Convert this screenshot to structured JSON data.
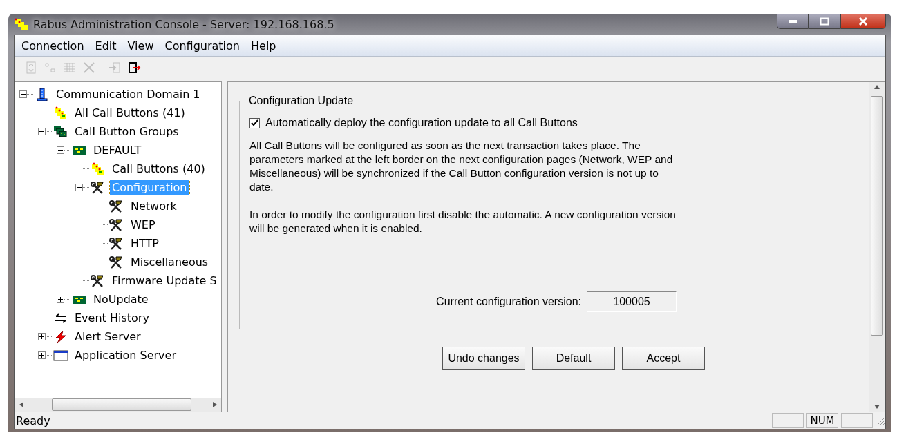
{
  "window": {
    "title": "Rabus Administration Console - Server: 192.168.168.5"
  },
  "menu": [
    "Connection",
    "Edit",
    "View",
    "Configuration",
    "Help"
  ],
  "toolbar": [
    {
      "kind": "refresh",
      "disabled": true
    },
    {
      "kind": "rename",
      "disabled": true
    },
    {
      "kind": "list",
      "disabled": true
    },
    {
      "kind": "delete",
      "disabled": true
    },
    {
      "kind": "sep"
    },
    {
      "kind": "login",
      "disabled": true
    },
    {
      "kind": "logout",
      "disabled": false
    }
  ],
  "tree": [
    {
      "label": "Communication Domain 1",
      "kind": "domain",
      "expanded": true,
      "selected": false,
      "children": [
        {
          "label": "All Call Buttons (41)",
          "kind": "buttons",
          "selected": false
        },
        {
          "label": "Call Button Groups",
          "kind": "groups",
          "expanded": true,
          "selected": false,
          "children": [
            {
              "label": "DEFAULT",
              "kind": "board",
              "expanded": true,
              "selected": false,
              "children": [
                {
                  "label": "Call Buttons (40)",
                  "kind": "buttons",
                  "selected": false
                },
                {
                  "label": "Configuration",
                  "kind": "tools",
                  "expanded": true,
                  "selected": true,
                  "children": [
                    {
                      "label": "Network",
                      "kind": "tools",
                      "selected": false
                    },
                    {
                      "label": "WEP",
                      "kind": "tools",
                      "selected": false
                    },
                    {
                      "label": "HTTP",
                      "kind": "tools",
                      "selected": false
                    },
                    {
                      "label": "Miscellaneous",
                      "kind": "tools",
                      "selected": false
                    }
                  ]
                },
                {
                  "label": "Firmware Update S",
                  "kind": "tools",
                  "selected": false
                }
              ]
            },
            {
              "label": "NoUpdate",
              "kind": "board",
              "expanded": false,
              "selected": false
            }
          ]
        },
        {
          "label": "Event History",
          "kind": "history",
          "selected": false
        },
        {
          "label": "Alert Server",
          "kind": "alert",
          "expanded": false,
          "selected": false
        },
        {
          "label": "Application Server",
          "kind": "app",
          "expanded": false,
          "selected": false
        }
      ]
    }
  ],
  "panel": {
    "group_title": "Configuration Update",
    "auto_deploy": {
      "label": "Automatically deploy the configuration update to all Call Buttons",
      "checked": true
    },
    "paragraphs": [
      "All Call Buttons will be configured as soon as the next transaction takes place. The parameters marked at the left border on the next configuration pages (Network, WEP and Miscellaneous) will be synchronized if the Call Button configuration version is not up to date.",
      "In order to modify the configuration first disable the automatic. A new configuration version will be generated when it is enabled."
    ],
    "version_label": "Current configuration version:",
    "version_value": "100005",
    "buttons": [
      "Undo changes",
      "Default",
      "Accept"
    ]
  },
  "status_bar": {
    "text": "Ready",
    "indicator": "NUM"
  }
}
